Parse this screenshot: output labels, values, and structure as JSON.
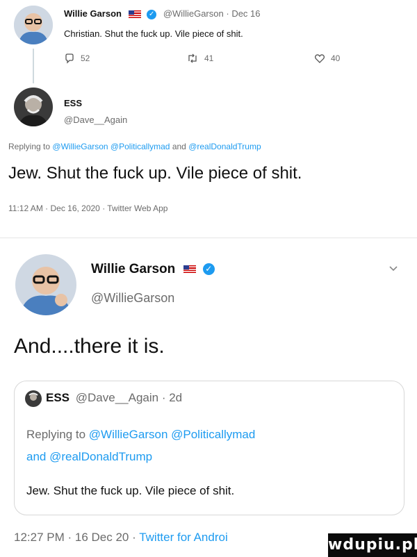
{
  "tweet1": {
    "name": "Willie Garson",
    "handle": "@WillieGarson",
    "date": "Dec 16",
    "text": "Christian. Shut the fuck up. Vile piece of shit.",
    "replies": "52",
    "retweets": "41",
    "likes": "40"
  },
  "tweet2": {
    "name": "ESS",
    "handle": "@Dave__Again",
    "replying_prefix": "Replying to",
    "replying_mentions": "@WillieGarson @Politicallymad",
    "replying_and": "and",
    "replying_last": "@realDonaldTrump",
    "text": "Jew. Shut the fuck up. Vile piece of shit.",
    "meta": "11:12 AM · Dec 16, 2020 · Twitter Web App"
  },
  "tweet3": {
    "name": "Willie Garson",
    "handle": "@WillieGarson",
    "text": "And....there it is.",
    "meta_time": "12:27 PM · 16 Dec 20 ·",
    "meta_source": "Twitter for Androi"
  },
  "quoted": {
    "name": "ESS",
    "handle_time": "@Dave__Again · 2d",
    "replying_prefix": "Replying to",
    "replying_mentions": "@WillieGarson @Politicallymad",
    "replying_and": "and",
    "replying_last": "@realDonaldTrump",
    "text": "Jew. Shut the fuck up. Vile piece of shit."
  },
  "watermark": "wdupiu.pl",
  "colors": {
    "link": "#1d9bf0",
    "text": "#111111",
    "muted": "#6b6b6b"
  }
}
